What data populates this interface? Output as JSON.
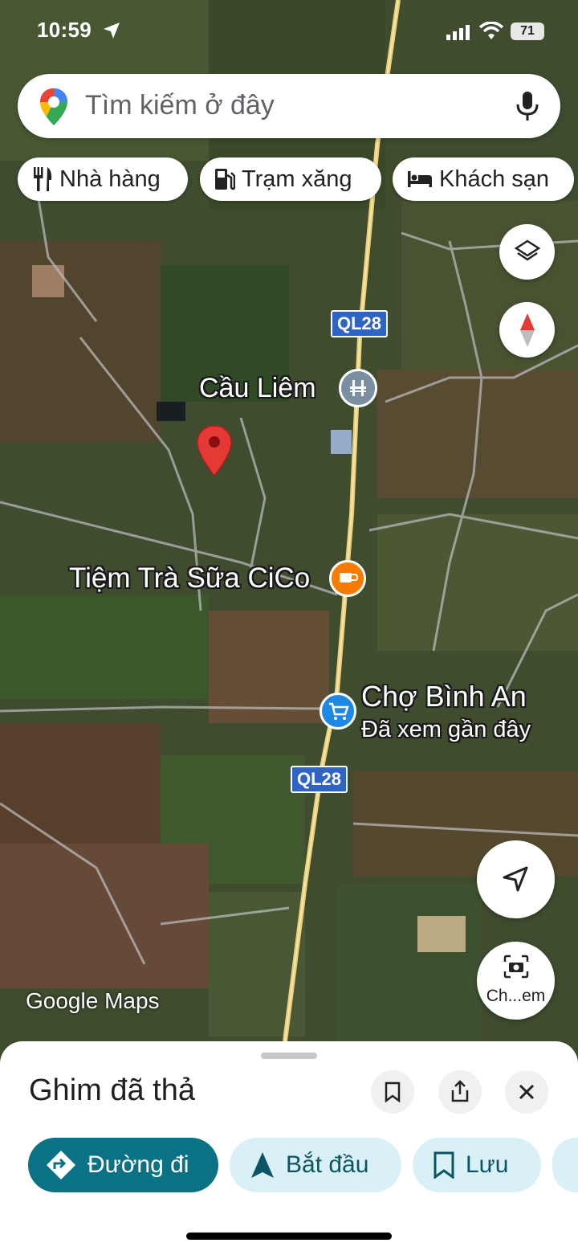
{
  "status_bar": {
    "time": "10:59",
    "battery": "71"
  },
  "search": {
    "placeholder": "Tìm kiếm ở đây"
  },
  "chips": [
    {
      "label": "Nhà hàng",
      "icon": "fork-knife-icon"
    },
    {
      "label": "Trạm xăng",
      "icon": "gas-station-icon"
    },
    {
      "label": "Khách sạn",
      "icon": "bed-icon"
    }
  ],
  "map": {
    "places": {
      "cau_liem": "Cầu Liêm",
      "tiem_tra_sua": "Tiệm Trà Sữa CiCo",
      "cho_binh_an": "Chợ Bình An",
      "cho_binh_an_sub": "Đã xem gần đây"
    },
    "road_shields": [
      "QL28",
      "QL28"
    ],
    "attribution": "Google Maps",
    "streetview_label": "Ch...em"
  },
  "sheet": {
    "title": "Ghim đã thả",
    "actions": [
      {
        "label": "Đường đi",
        "icon": "directions-icon",
        "style": "primary"
      },
      {
        "label": "Bắt đầu",
        "icon": "navigation-arrow-icon"
      },
      {
        "label": "Lưu",
        "icon": "bookmark-icon"
      }
    ]
  },
  "colors": {
    "accent": "#0b7285",
    "pin": "#e53935",
    "chip_bg": "#d9f1f6"
  }
}
